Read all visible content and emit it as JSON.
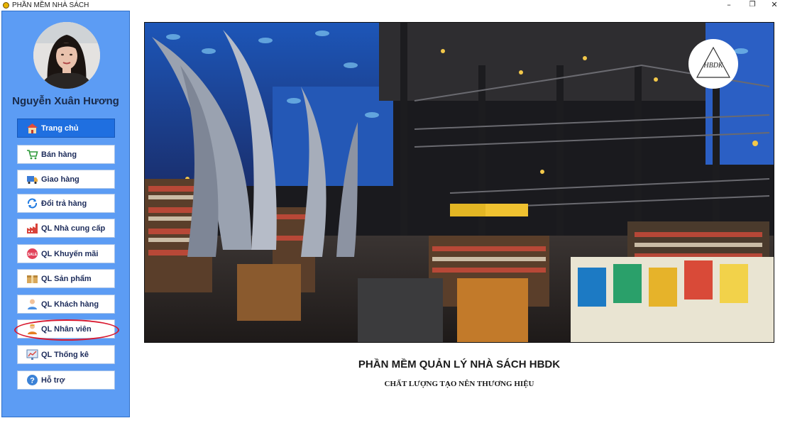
{
  "window": {
    "title": "PHẦN MỀM NHÀ SÁCH",
    "minimize_glyph": "–",
    "restore_glyph": "❐",
    "close_glyph": "✕"
  },
  "user": {
    "name": "Nguyễn Xuân Hương"
  },
  "nav": [
    {
      "label": "Trang chủ",
      "icon": "home-icon",
      "active": true
    },
    {
      "label": "Bán hàng",
      "icon": "cart-icon",
      "active": false
    },
    {
      "label": "Giao hàng",
      "icon": "truck-icon",
      "active": false
    },
    {
      "label": "Đổi trả hàng",
      "icon": "return-icon",
      "active": false
    },
    {
      "label": "QL Nhà cung cấp",
      "icon": "factory-icon",
      "active": false
    },
    {
      "label": "QL Khuyến mãi",
      "icon": "sale-tag-icon",
      "active": false
    },
    {
      "label": "QL Sản phẩm",
      "icon": "box-icon",
      "active": false
    },
    {
      "label": "QL Khách hàng",
      "icon": "customer-icon",
      "active": false
    },
    {
      "label": "QL Nhân viên",
      "icon": "employee-icon",
      "active": false
    },
    {
      "label": "QL Thống kê",
      "icon": "statistics-icon",
      "active": false
    },
    {
      "label": "Hỗ trợ",
      "icon": "help-icon",
      "active": false
    }
  ],
  "main": {
    "logo_text": "HBDK",
    "title": "PHẦN MỀM QUẢN LÝ NHÀ SÁCH HBDK",
    "subtitle": "CHẤT LƯỢNG TẠO NÊN THƯƠNG HIỆU"
  },
  "colors": {
    "sidebar_bg": "#5c9cf4",
    "active_nav_bg": "#1f6fe0",
    "highlight_ring": "#d8182f"
  }
}
